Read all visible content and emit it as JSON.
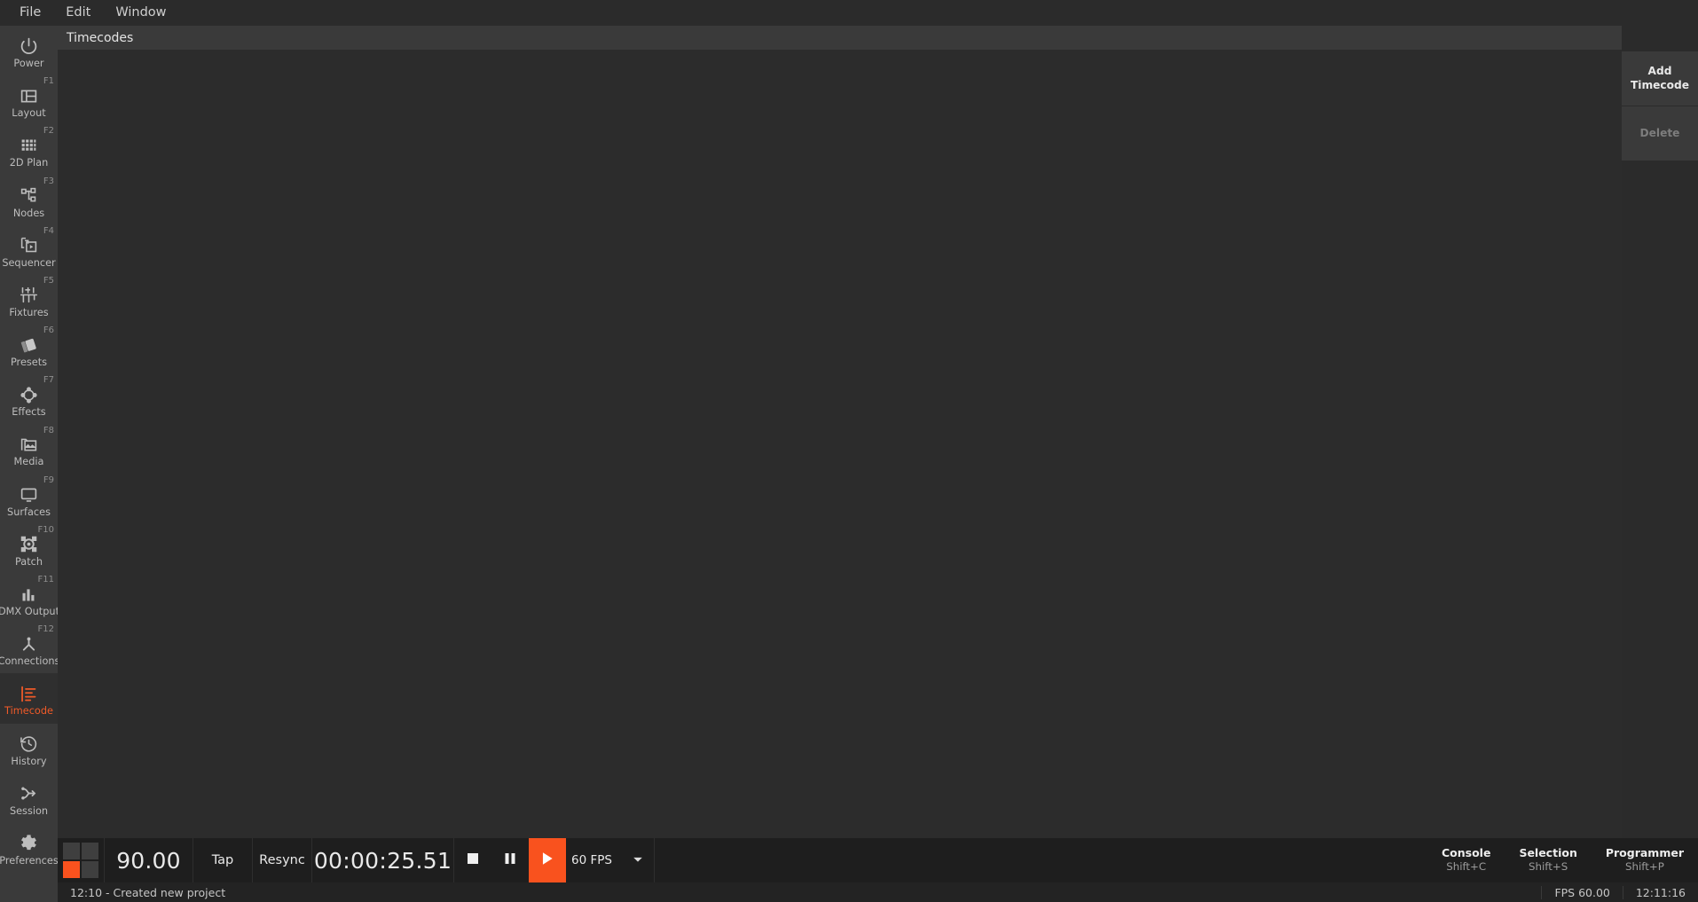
{
  "menubar": {
    "items": [
      {
        "label": "File"
      },
      {
        "label": "Edit"
      },
      {
        "label": "Window"
      }
    ]
  },
  "sidebar": {
    "items": [
      {
        "label": "Power",
        "fkey": "",
        "icon": "power-icon",
        "active": false
      },
      {
        "label": "Layout",
        "fkey": "F1",
        "icon": "layout-icon",
        "active": false
      },
      {
        "label": "2D Plan",
        "fkey": "F2",
        "icon": "grid-icon",
        "active": false
      },
      {
        "label": "Nodes",
        "fkey": "F3",
        "icon": "nodes-icon",
        "active": false
      },
      {
        "label": "Sequencer",
        "fkey": "F4",
        "icon": "sequencer-icon",
        "active": false
      },
      {
        "label": "Fixtures",
        "fkey": "F5",
        "icon": "faders-icon",
        "active": false
      },
      {
        "label": "Presets",
        "fkey": "F6",
        "icon": "presets-icon",
        "active": false
      },
      {
        "label": "Effects",
        "fkey": "F7",
        "icon": "effects-icon",
        "active": false
      },
      {
        "label": "Media",
        "fkey": "F8",
        "icon": "media-icon",
        "active": false
      },
      {
        "label": "Surfaces",
        "fkey": "F9",
        "icon": "monitor-icon",
        "active": false
      },
      {
        "label": "Patch",
        "fkey": "F10",
        "icon": "patch-icon",
        "active": false
      },
      {
        "label": "DMX Output",
        "fkey": "F11",
        "icon": "bars-icon",
        "active": false
      },
      {
        "label": "Connections",
        "fkey": "F12",
        "icon": "connections-icon",
        "active": false
      },
      {
        "label": "Timecode",
        "fkey": "",
        "icon": "timecode-icon",
        "active": true
      },
      {
        "label": "History",
        "fkey": "",
        "icon": "history-icon",
        "active": false
      },
      {
        "label": "Session",
        "fkey": "",
        "icon": "session-icon",
        "active": false
      },
      {
        "label": "Preferences",
        "fkey": "",
        "icon": "gear-icon",
        "active": false
      }
    ]
  },
  "panel": {
    "title": "Timecodes",
    "list_items": []
  },
  "right_rail": {
    "buttons": [
      {
        "label": "Add Timecode",
        "disabled": false
      },
      {
        "label": "Delete",
        "disabled": true
      }
    ]
  },
  "transport": {
    "bpm": "90.00",
    "tap_label": "Tap",
    "resync_label": "Resync",
    "timecode": "00:00:25.51",
    "stop_icon": "stop-icon",
    "pause_icon": "pause-icon",
    "play_icon": "play-icon",
    "fps_label": "60 FPS",
    "fps_caret_icon": "chevron-down-icon",
    "shortcuts": [
      {
        "title": "Console",
        "key": "Shift+C"
      },
      {
        "title": "Selection",
        "key": "Shift+S"
      },
      {
        "title": "Programmer",
        "key": "Shift+P"
      }
    ]
  },
  "statusbar": {
    "message": "12:10 - Created new project",
    "fps": "FPS 60.00",
    "clock": "12:11:16"
  },
  "colors": {
    "accent": "#f9521e",
    "sidebar_bg": "#3a3a3a",
    "panel_bg": "#2c2c2c",
    "transport_bg": "#1e1e1e",
    "status_bg": "#232323"
  }
}
